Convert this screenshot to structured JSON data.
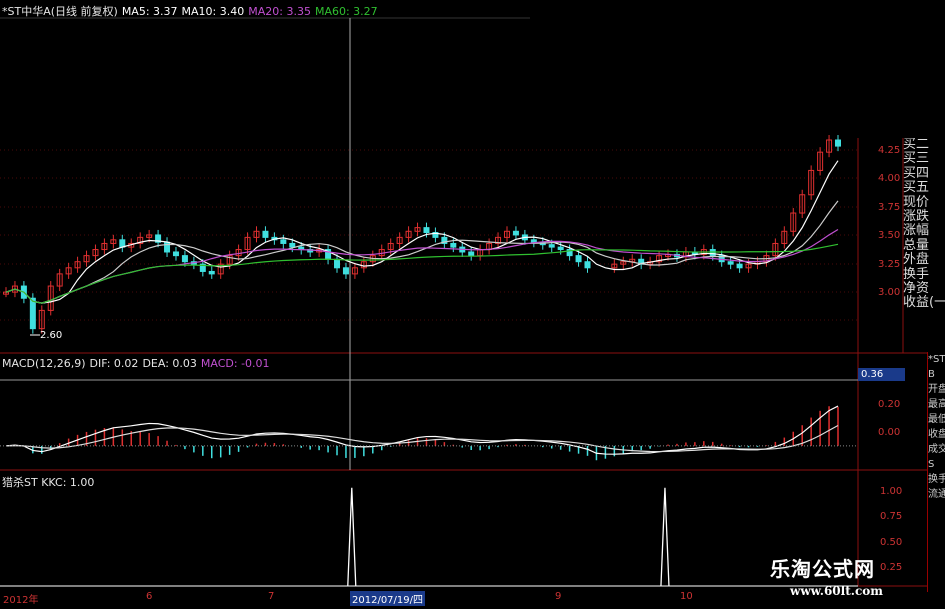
{
  "main_panel": {
    "legend": [
      {
        "text": "*ST中华A(日线 前复权)",
        "color": "#e6e6e6"
      },
      {
        "text": "MA5: 3.37",
        "color": "#ffffff"
      },
      {
        "text": "MA10: 3.40",
        "color": "#ffffff"
      },
      {
        "text": "MA20: 3.35",
        "color": "#c050d0"
      },
      {
        "text": "MA60: 3.27",
        "color": "#30c030"
      }
    ],
    "low_label": "2.60",
    "y_ticks": [
      "4.25",
      "4.00",
      "3.75",
      "3.50",
      "3.25",
      "3.00"
    ],
    "ylim": [
      2.55,
      4.3
    ],
    "candles": [
      3.05,
      3.1,
      3.0,
      2.75,
      2.9,
      3.1,
      3.2,
      3.25,
      3.3,
      3.35,
      3.4,
      3.45,
      3.48,
      3.42,
      3.45,
      3.5,
      3.52,
      3.46,
      3.38,
      3.35,
      3.3,
      3.28,
      3.22,
      3.2,
      3.28,
      3.35,
      3.4,
      3.5,
      3.55,
      3.5,
      3.48,
      3.45,
      3.42,
      3.4,
      3.38,
      3.4,
      3.32,
      3.25,
      3.2,
      3.25,
      3.3,
      3.35,
      3.4,
      3.45,
      3.5,
      3.55,
      3.58,
      3.54,
      3.5,
      3.45,
      3.42,
      3.38,
      3.35,
      3.4,
      3.45,
      3.5,
      3.55,
      3.52,
      3.48,
      3.46,
      3.44,
      3.42,
      3.4,
      3.35,
      3.3,
      3.25,
      3.1,
      3.25,
      3.28,
      3.3,
      3.32,
      3.28,
      3.3,
      3.35,
      3.36,
      3.34,
      3.38,
      3.36,
      3.4,
      3.35,
      3.3,
      3.28,
      3.25,
      3.28,
      3.3,
      3.35,
      3.45,
      3.55,
      3.7,
      3.85,
      4.05,
      4.2,
      4.3,
      4.25
    ]
  },
  "sidebar_labels": [
    "买二",
    "买三",
    "买四",
    "买五",
    "现价",
    "涨跌",
    "涨幅",
    "总量",
    "外盘",
    "换手",
    "净资",
    "收益(一)"
  ],
  "macd_panel": {
    "legend": [
      {
        "text": "MACD(12,26,9)",
        "color": "#e6e6e6"
      },
      {
        "text": "DIF: 0.02",
        "color": "#e6e6e6"
      },
      {
        "text": "DEA: 0.03",
        "color": "#e6e6e6"
      },
      {
        "text": "MACD: -0.01",
        "color": "#c050d0"
      }
    ],
    "value_badge": "0.36",
    "y_ticks": [
      "0.20",
      "0.00"
    ],
    "ylim": [
      -0.13,
      0.42
    ]
  },
  "kkc_panel": {
    "legend": [
      {
        "text": "猎杀ST KKC: 1.00",
        "color": "#e6e6e6"
      }
    ],
    "y_ticks": [
      "1.00",
      "0.75",
      "0.50",
      "0.25"
    ],
    "ylim": [
      0,
      1.1
    ],
    "spikes": [
      {
        "x_frac": 0.41,
        "value": 1.0
      },
      {
        "x_frac": 0.775,
        "value": 1.0
      }
    ]
  },
  "right_panel_labels": [
    "*ST",
    "B",
    "开盘",
    "最高",
    "最低",
    "收盘",
    "成交",
    "S",
    "换手",
    "流通"
  ],
  "x_axis": {
    "labels": [
      "2012年",
      "6",
      "7",
      "9",
      "10"
    ],
    "cursor_date": "2012/07/19/四"
  },
  "watermark": {
    "title": "乐淘公式网",
    "url": "www.60lt.com"
  },
  "colors": {
    "up": "#e03030",
    "down": "#40e0e0",
    "axis": "#8b1010",
    "ma5": "#ffffff",
    "ma20": "#c050d0",
    "ma60": "#30c030"
  }
}
